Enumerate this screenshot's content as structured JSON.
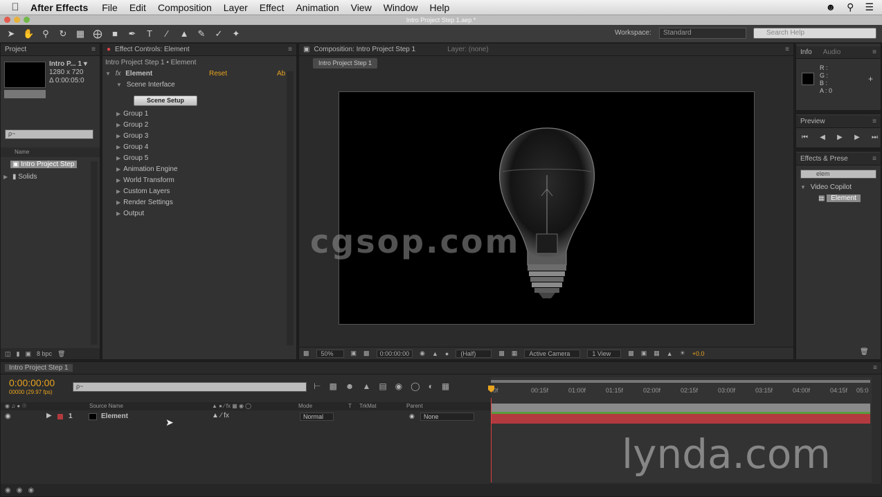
{
  "menubar": {
    "app_name": "After Effects",
    "items": [
      "File",
      "Edit",
      "Composition",
      "Layer",
      "Effect",
      "Animation",
      "View",
      "Window",
      "Help"
    ]
  },
  "window_title": "Intro Project Step 1.aep *",
  "toolbar": {
    "workspace_label": "Workspace:",
    "workspace_value": "Standard",
    "search_placeholder": "Search Help"
  },
  "project_panel": {
    "tab_label": "Project",
    "item_name": "Intro P... 1 ▾",
    "item_size": "1280 x 720",
    "item_duration": "Δ 0:00:05:0",
    "search_placeholder": "ρ~",
    "col_name": "Name",
    "items": [
      {
        "label": "Intro Project Step",
        "type": "comp"
      },
      {
        "label": "Solids",
        "type": "folder"
      }
    ],
    "bpc_label": "8 bpc"
  },
  "effect_controls": {
    "tab_label": "Effect Controls: Element",
    "breadcrumb": "Intro Project Step 1 • Element",
    "effect_name": "Element",
    "reset_label": "Reset",
    "about_label": "Ab",
    "scene_interface": "Scene Interface",
    "scene_setup_button": "Scene Setup",
    "groups": [
      "Group 1",
      "Group 2",
      "Group 3",
      "Group 4",
      "Group 5",
      "Animation Engine",
      "World Transform",
      "Custom Layers",
      "Render Settings",
      "Output"
    ]
  },
  "composition_panel": {
    "tab_label": "Composition: Intro Project Step 1",
    "layer_tab": "Layer: (none)",
    "comp_tab": "Intro Project Step 1",
    "zoom": "50%",
    "timecode": "0:00:00:00",
    "resolution": "(Half)",
    "camera": "Active Camera",
    "view": "1 View",
    "exposure": "+0.0"
  },
  "info_panel": {
    "tab_info": "Info",
    "tab_audio": "Audio",
    "r": "R :",
    "g": "G :",
    "b": "B :",
    "a": "A : 0"
  },
  "preview_panel": {
    "tab_label": "Preview"
  },
  "effects_presets": {
    "tab_label": "Effects & Prese",
    "search_value": "elem",
    "category": "Video Copilot",
    "item": "Element"
  },
  "timeline": {
    "tab_label": "Intro Project Step 1",
    "timecode": "0:00:00:00",
    "frame_info": "00000 (29.97 fps)",
    "search_placeholder": "ρ~",
    "columns": {
      "source_name": "Source Name",
      "mode": "Mode",
      "t": "T",
      "trkmat": "TrkMat",
      "parent": "Parent"
    },
    "layer": {
      "number": "1",
      "name": "Element",
      "mode": "Normal",
      "parent": "None"
    },
    "ruler_ticks": [
      "0f",
      "00:15f",
      "01:00f",
      "01:15f",
      "02:00f",
      "02:15f",
      "03:00f",
      "03:15f",
      "04:00f",
      "04:15f",
      "05:0"
    ]
  },
  "watermarks": {
    "cgsop": "cgsop.com",
    "lynda": "lynda.com"
  },
  "colors": {
    "accent_orange": "#e8a31f",
    "timeline_layer_bar": "#b23a3f",
    "timeline_work_bar": "#5a9b3f",
    "panel_bg": "#323232"
  }
}
